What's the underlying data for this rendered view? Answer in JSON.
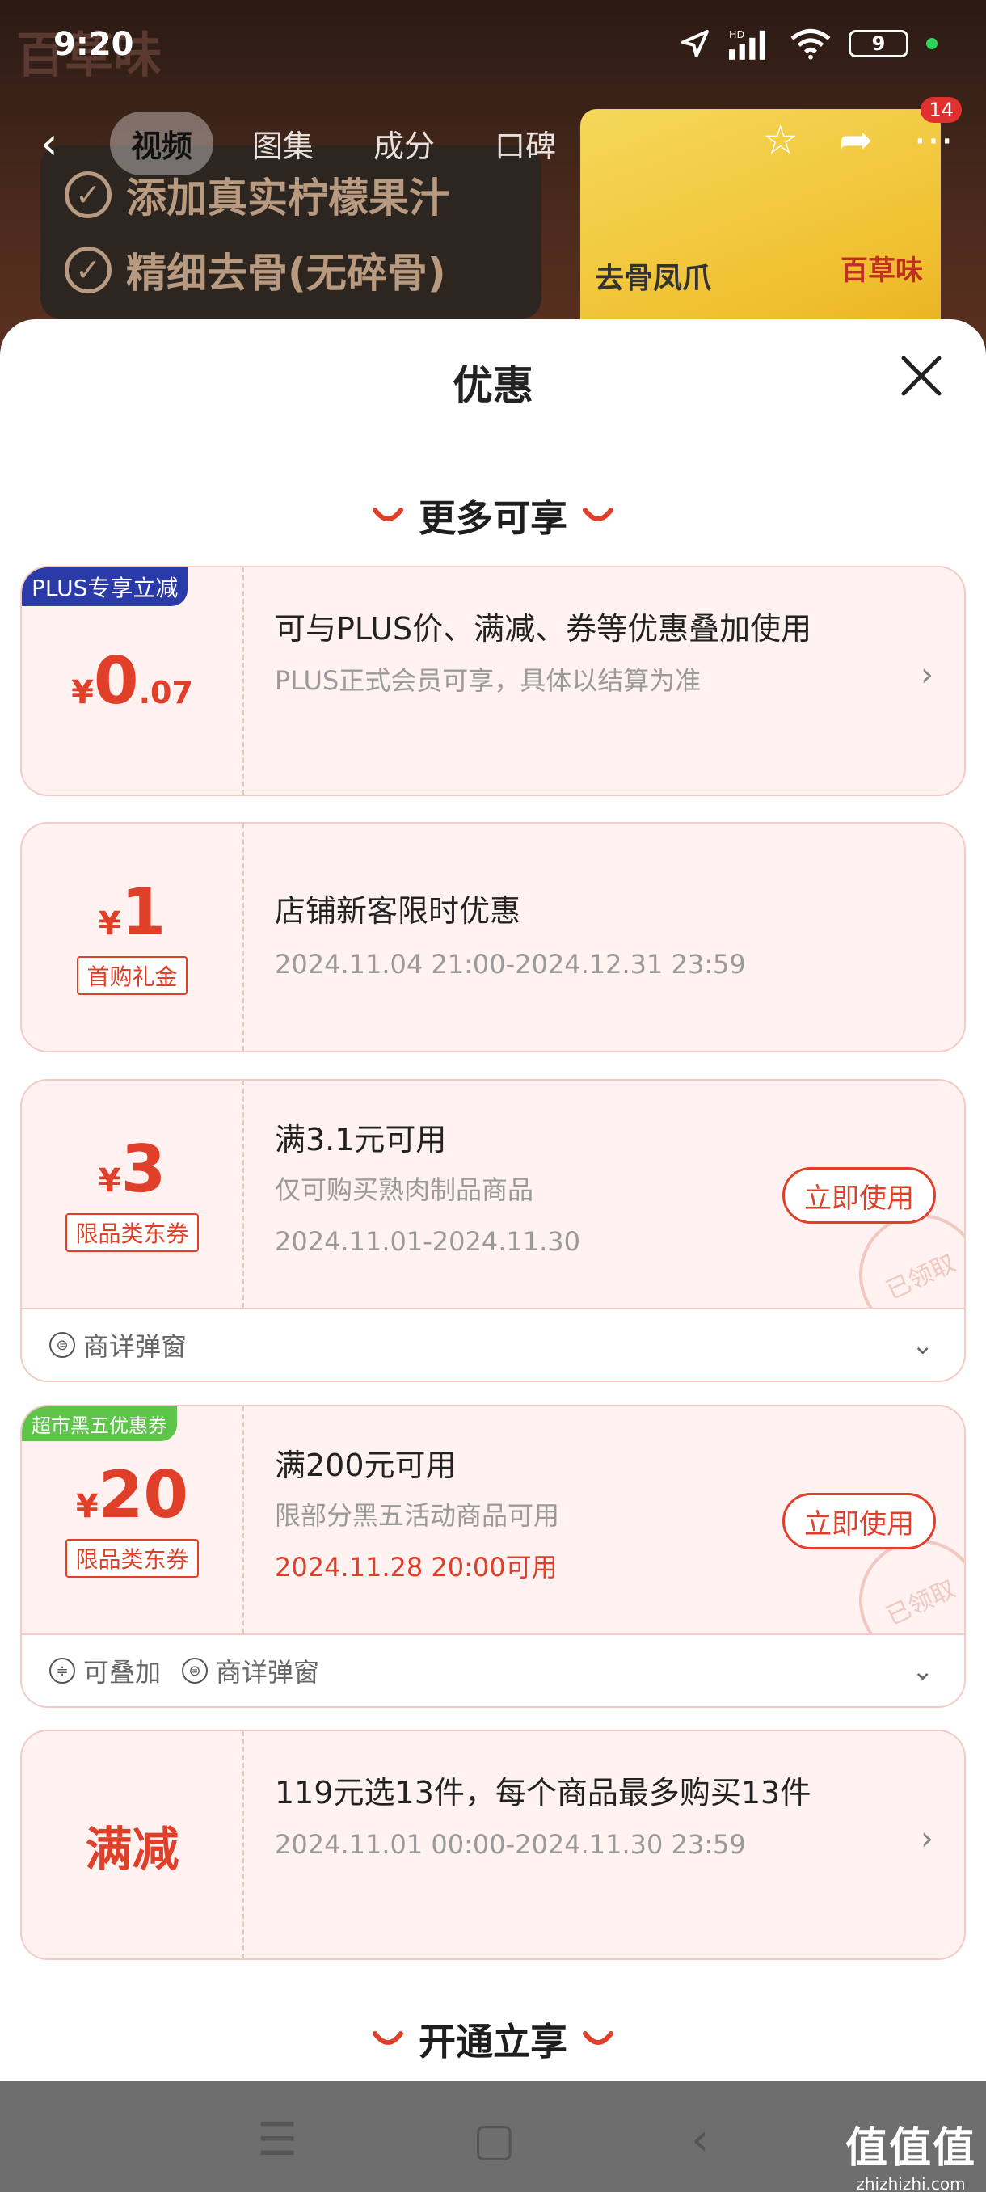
{
  "status_bar": {
    "time": "9:20",
    "battery": "9",
    "network": "HD"
  },
  "background": {
    "brand_ghost": "百草味",
    "banner_lines": [
      "添加真实柠檬果汁",
      "精细去骨(无碎骨)"
    ],
    "product_name": "去骨凤爪",
    "product_brand": "百草味"
  },
  "nav": {
    "tabs": [
      "视频",
      "图集",
      "成分",
      "口碑"
    ],
    "badge": "14"
  },
  "sheet": {
    "title": "优惠"
  },
  "sections": {
    "more": "更多可享",
    "open": "开通立享"
  },
  "cards": {
    "plus": {
      "corner_tag": "PLUS专享立减",
      "yen": "¥",
      "amount_int": "0",
      "amount_dec": ".07",
      "title": "可与PLUS价、满减、券等优惠叠加使用",
      "sub": "PLUS正式会员可享，具体以结算为准"
    },
    "newcust": {
      "yen": "¥",
      "amount": "1",
      "tag": "首购礼金",
      "title": "店铺新客限时优惠",
      "sub": "2024.11.04 21:00-2024.12.31 23:59"
    },
    "coupon3": {
      "yen": "¥",
      "amount": "3",
      "tag": "限品类东券",
      "title": "满3.1元可用",
      "sub": "仅可购买熟肉制品商品",
      "date": "2024.11.01-2024.11.30",
      "button": "立即使用",
      "stamp": "已领取",
      "foot": [
        "商详弹窗"
      ]
    },
    "coupon20": {
      "corner_tag": "超市黑五优惠券",
      "yen": "¥",
      "amount": "20",
      "tag": "限品类东券",
      "title": "满200元可用",
      "sub": "限部分黑五活动商品可用",
      "date": "2024.11.28 20:00可用",
      "button": "立即使用",
      "stamp": "已领取",
      "foot": [
        "可叠加",
        "商详弹窗"
      ]
    },
    "manjian": {
      "label": "满减",
      "title": "119元选13件，每个商品最多购买13件",
      "sub": "2024.11.01 00:00-2024.11.30 23:59"
    }
  },
  "watermark": {
    "big": "值值值",
    "small": "zhizhizhi.com"
  },
  "colors": {
    "accent": "#e0402a",
    "plus_blue": "#2a3aa8",
    "green": "#5ec54a"
  }
}
